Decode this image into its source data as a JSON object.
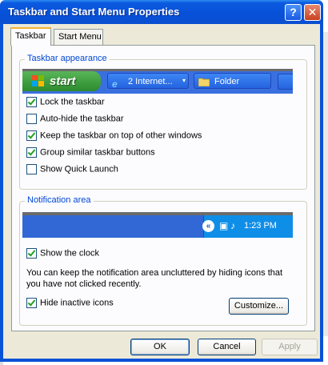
{
  "window": {
    "title": "Taskbar and Start Menu Properties",
    "help_symbol": "?",
    "close_symbol": "✕"
  },
  "tabs": [
    {
      "label": "Taskbar",
      "selected": true
    },
    {
      "label": "Start Menu",
      "selected": false
    }
  ],
  "taskbar_appearance": {
    "legend": "Taskbar appearance",
    "preview": {
      "start_label": "start",
      "task1_label": "2 Internet...",
      "task2_label": "Folder",
      "task1_icon": "internet-explorer-icon",
      "task2_icon": "folder-icon"
    },
    "options": [
      {
        "label": "Lock the taskbar",
        "checked": true
      },
      {
        "label": "Auto-hide the taskbar",
        "checked": false
      },
      {
        "label": "Keep the taskbar on top of other windows",
        "checked": true
      },
      {
        "label": "Group similar taskbar buttons",
        "checked": true
      },
      {
        "label": "Show Quick Launch",
        "checked": false
      }
    ]
  },
  "notification_area": {
    "legend": "Notification area",
    "clock_text": "1:23 PM",
    "show_clock": {
      "label": "Show the clock",
      "checked": true
    },
    "description": "You can keep the notification area uncluttered by hiding icons that you have not clicked recently.",
    "hide_inactive": {
      "label": "Hide inactive icons",
      "checked": true
    },
    "customize_label": "Customize..."
  },
  "buttons": {
    "ok": "OK",
    "cancel": "Cancel",
    "apply": "Apply"
  },
  "colors": {
    "title_bar": "#0a52d6",
    "dialog_face": "#ece9d8",
    "start_green": "#3c9c3c",
    "group_legend": "#0046d5"
  }
}
